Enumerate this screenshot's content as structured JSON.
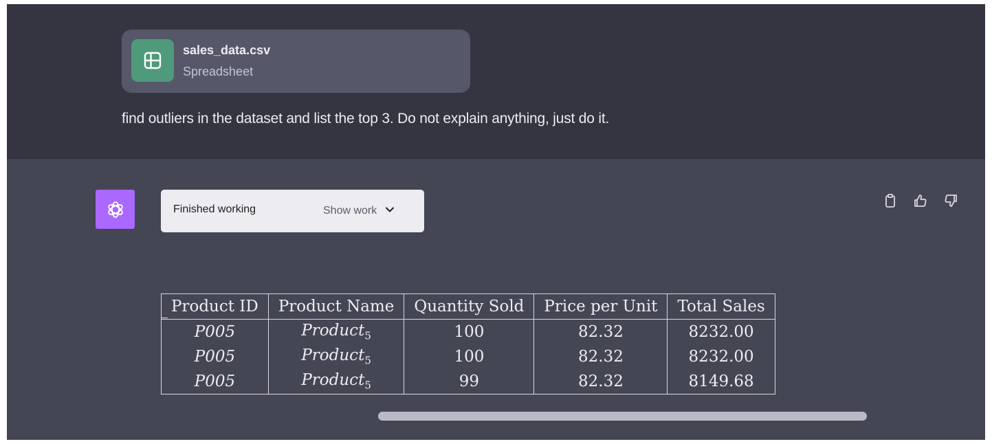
{
  "attachment": {
    "file_name": "sales_data.csv",
    "file_type": "Spreadsheet",
    "icon": "spreadsheet-icon",
    "icon_color": "#4e9a7a"
  },
  "user_message": "find outliers in the dataset and list the top 3. Do not explain anything, just do it.",
  "assistant": {
    "avatar_icon": "openai-logo-icon",
    "avatar_color": "#ab68ff",
    "status_label": "Finished working",
    "show_work_label": "Show work",
    "actions": [
      "copy-icon",
      "thumbs-up-icon",
      "thumbs-down-icon"
    ]
  },
  "table": {
    "headers": [
      "Product ID",
      "Product Name",
      "Quantity Sold",
      "Price per Unit",
      "Total Sales"
    ],
    "rows": [
      [
        "P005",
        "Product",
        "5",
        "100",
        "82.32",
        "8232.00"
      ],
      [
        "P005",
        "Product",
        "5",
        "100",
        "82.32",
        "8232.00"
      ],
      [
        "P005",
        "Product",
        "5",
        "99",
        "82.32",
        "8149.68"
      ]
    ]
  },
  "colors": {
    "user_bg": "#343541",
    "assistant_bg": "#444654",
    "text": "#ececf1"
  }
}
